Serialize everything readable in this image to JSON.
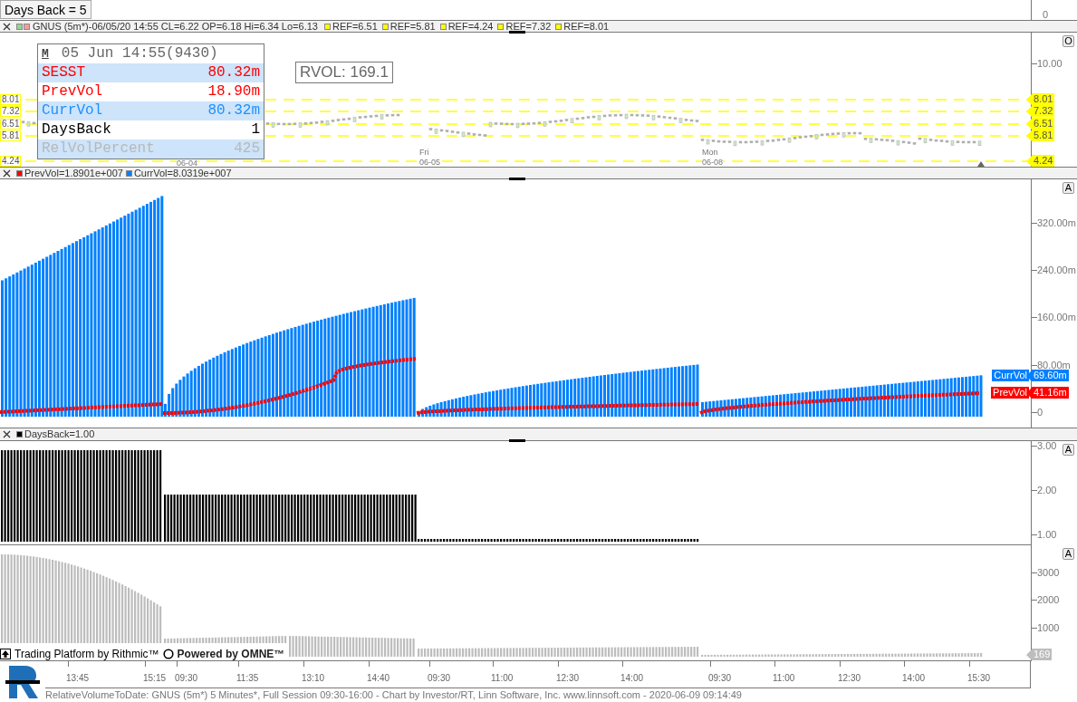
{
  "days_back_button": "Days Back = 5",
  "top_axis_label": "0",
  "price_panel": {
    "legend_title": "GNUS (5m*)-06/05/20 14:55 CL=6.22 OP=6.18 Hi=6.34 Lo=6.13",
    "legend_swatches": [
      {
        "color": "#8fd88f"
      },
      {
        "color": "#f0a0a0"
      }
    ],
    "refs": [
      {
        "label": "REF=6.51",
        "color": "#ffff00"
      },
      {
        "label": "REF=5.81",
        "color": "#ffff00"
      },
      {
        "label": "REF=4.24",
        "color": "#ffff00"
      },
      {
        "label": "REF=7.32",
        "color": "#ffff00"
      },
      {
        "label": "REF=8.01",
        "color": "#ffff00"
      }
    ],
    "axis_labels": [
      "10.00"
    ],
    "levels": [
      "8.01",
      "7.32",
      "6.51",
      "5.81",
      "4.24"
    ],
    "level_tags": [
      "8.01",
      "7.32",
      "6.51",
      "5.81",
      "4.24"
    ],
    "date_labels": [
      "06-04",
      "Fri",
      "06-05",
      "Mon",
      "06-08"
    ],
    "corner_button": "O",
    "rvol": "RVOL: 169.1",
    "info_box": {
      "mode": "M",
      "title": "05 Jun 14:55(9430)",
      "rows": [
        {
          "label": "SESST",
          "value": "80.32m",
          "color": "#ff0000",
          "shaded": true
        },
        {
          "label": "PrevVol",
          "value": "18.90m",
          "color": "#ff0000",
          "shaded": false
        },
        {
          "label": "CurrVol",
          "value": "80.32m",
          "color": "#1e90ff",
          "shaded": true
        },
        {
          "label": "DaysBack",
          "value": "1",
          "color": "#000000",
          "shaded": false
        },
        {
          "label": "RelVolPercent",
          "value": "425",
          "color": "#b8b8b8",
          "shaded": true
        }
      ]
    }
  },
  "volume_panel": {
    "legend": [
      {
        "label": "PrevVol=1.8901e+007",
        "color": "#ff0000"
      },
      {
        "label": "CurrVol=8.0319e+007",
        "color": "#0080ff"
      }
    ],
    "axis_labels": [
      "320.00m",
      "240.00m",
      "160.00m",
      "80.00m",
      "0"
    ],
    "tags": [
      {
        "label": "CurrVol",
        "value": "69.60m",
        "color": "#0080ff"
      },
      {
        "label": "PrevVol",
        "value": "41.16m",
        "color": "#ff0000"
      }
    ],
    "corner_button": "A"
  },
  "days_back_panel": {
    "legend": [
      {
        "label": "DaysBack=1.00",
        "color": "#000000"
      }
    ],
    "axis_labels": [
      "3.00",
      "2.00",
      "1.00"
    ],
    "corner_button": "A"
  },
  "rel_volume_panel": {
    "axis_labels": [
      "3000",
      "2000",
      "1000"
    ],
    "tag": "169",
    "corner_button": "A",
    "branding": [
      "Trading Platform by Rithmic™",
      "Powered by OMNE™"
    ]
  },
  "time_axis": [
    "13:45",
    "15:15",
    "09:30",
    "11:35",
    "13:10",
    "14:40",
    "09:30",
    "11:00",
    "12:30",
    "14:00",
    "09:30",
    "11:00",
    "12:30",
    "14:00",
    "15:30"
  ],
  "footer": "RelativeVolumeToDate: GNUS (5m*) 5 Minutes*, Full Session 09:30-16:00 - Chart by Investor/RT, Linn Software, Inc. www.linnsoft.com - 2020-06-09 09:14:49"
}
